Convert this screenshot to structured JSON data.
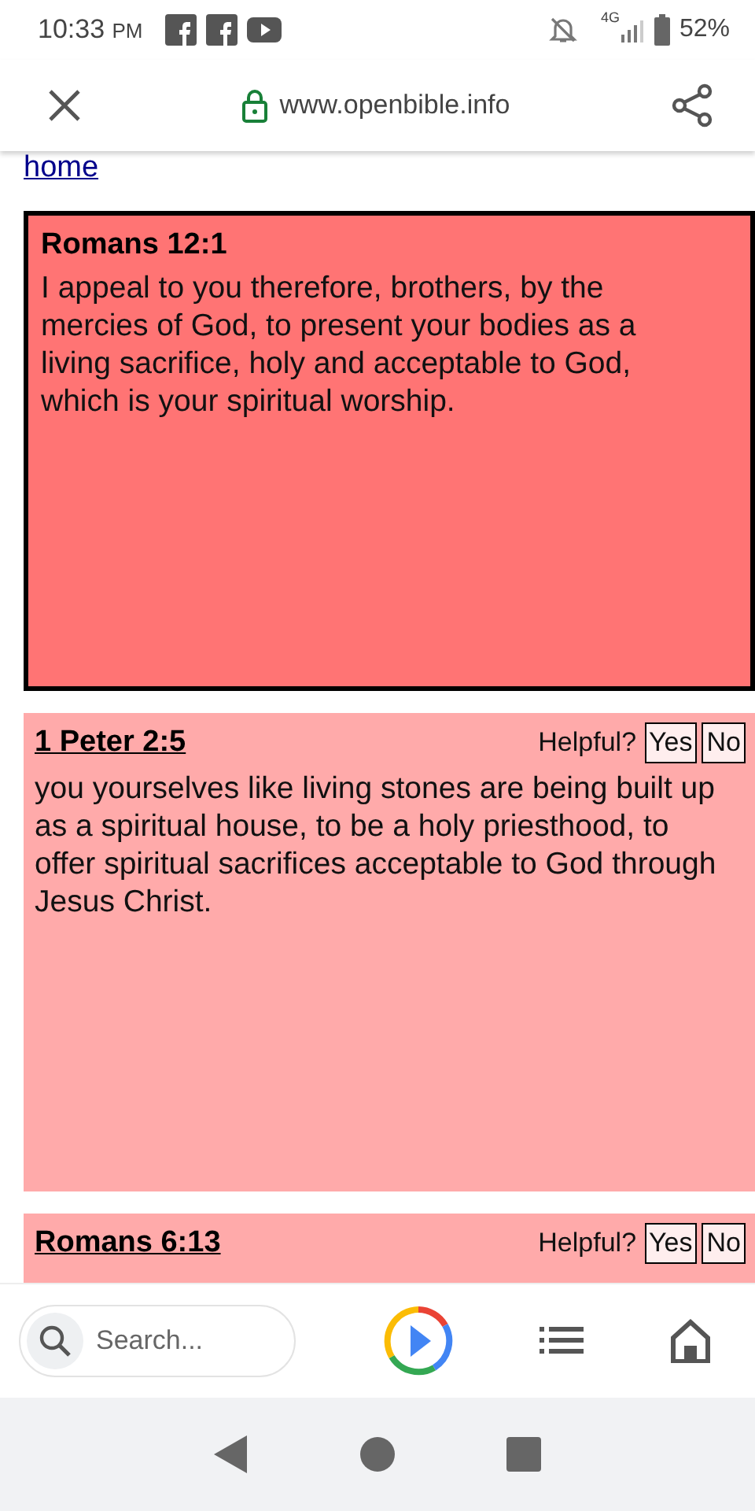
{
  "status_bar": {
    "time": "10:33",
    "ampm": "PM",
    "battery": "52%",
    "network": "4G"
  },
  "browser": {
    "url": "www.openbible.info"
  },
  "home_link": "home",
  "verses": [
    {
      "kind": "featured",
      "reference": "Romans 12:1",
      "text": "I appeal to you therefore, brothers, by the mercies of God, to present your bodies as a living sacrifice, holy and acceptable to God, which is your spiritual worship."
    },
    {
      "kind": "result",
      "reference": "1 Peter 2:5",
      "helpful": "Helpful?",
      "yes": "Yes",
      "no": "No",
      "text": "you yourselves like living stones are being built up as a spiritual house, to be a holy priesthood, to offer spiritual sacrifices acceptable to God through Jesus Christ."
    },
    {
      "kind": "result",
      "reference": "Romans 6:13",
      "helpful": "Helpful?",
      "yes": "Yes",
      "no": "No"
    }
  ],
  "bottom_bar": {
    "search_placeholder": "Search..."
  }
}
